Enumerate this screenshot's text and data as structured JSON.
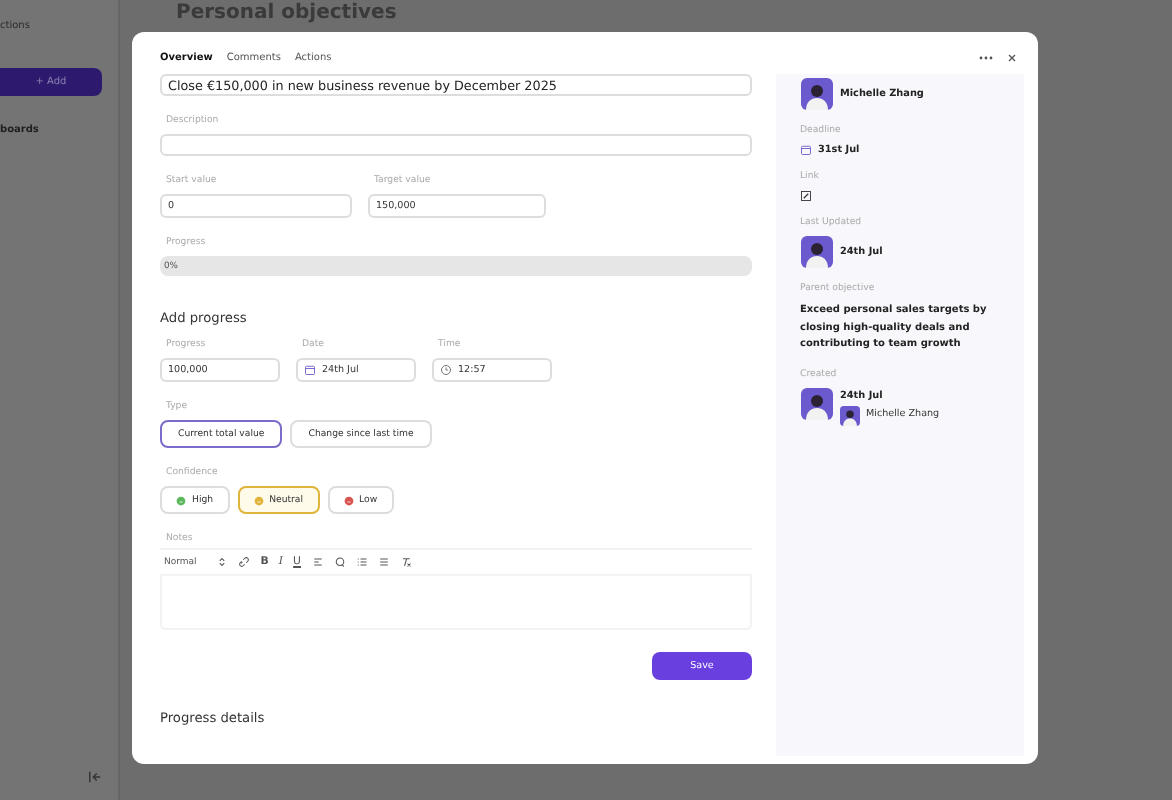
{
  "sidebar": {
    "top_item": "ctions",
    "add_button": "+ Add",
    "section": "boards"
  },
  "page_title": "Personal objectives",
  "modal": {
    "tabs": [
      {
        "label": "Overview",
        "selected": true
      },
      {
        "label": "Comments",
        "selected": false
      },
      {
        "label": "Actions",
        "selected": false
      }
    ],
    "objective_title": "Close €150,000 in new business revenue by December 2025",
    "description": {
      "label": "Description"
    },
    "start_value": {
      "label": "Start value",
      "value": "0"
    },
    "target_value": {
      "label": "Target value",
      "value": "150,000"
    },
    "progress": {
      "label": "Progress",
      "level": 0,
      "reading": "0%"
    },
    "add_progress": {
      "heading": "Add progress",
      "fields": [
        {
          "kind": "text",
          "label": "Progress",
          "value": "100,000"
        },
        {
          "kind": "date",
          "label": "Date",
          "value": "24th Jul"
        },
        {
          "kind": "time",
          "label": "Time",
          "value": "12:57"
        }
      ],
      "type": {
        "label": "Type",
        "options": [
          {
            "label": "Current total value",
            "selected": true
          },
          {
            "label": "Change since last time",
            "selected": false
          }
        ]
      },
      "confidence": {
        "label": "Confidence",
        "options": [
          {
            "label": "High",
            "selected": false,
            "color": "#5cb85c"
          },
          {
            "label": "Neutral",
            "selected": true,
            "color": "#e0b43a"
          },
          {
            "label": "Low",
            "selected": false,
            "color": "#d9534f"
          }
        ]
      },
      "notes": {
        "label": "Notes",
        "style": "Normal",
        "format_buttons": [
          "B",
          "I",
          "U"
        ]
      },
      "save_button": "Save"
    },
    "progress_details": "Progress details",
    "details": {
      "owner": "Michelle Zhang",
      "deadline": {
        "label": "Deadline",
        "value": "31st Jul"
      },
      "link": {
        "label": "Link"
      },
      "last_updated": {
        "label": "Last Updated",
        "value": "24th Jul"
      },
      "parent_objective": {
        "label": "Parent objective",
        "value": "Exceed personal sales targets by closing high-quality deals and contributing to team growth"
      },
      "created": {
        "label": "Created",
        "date": "24th Jul",
        "by": "Michelle Zhang"
      }
    }
  }
}
